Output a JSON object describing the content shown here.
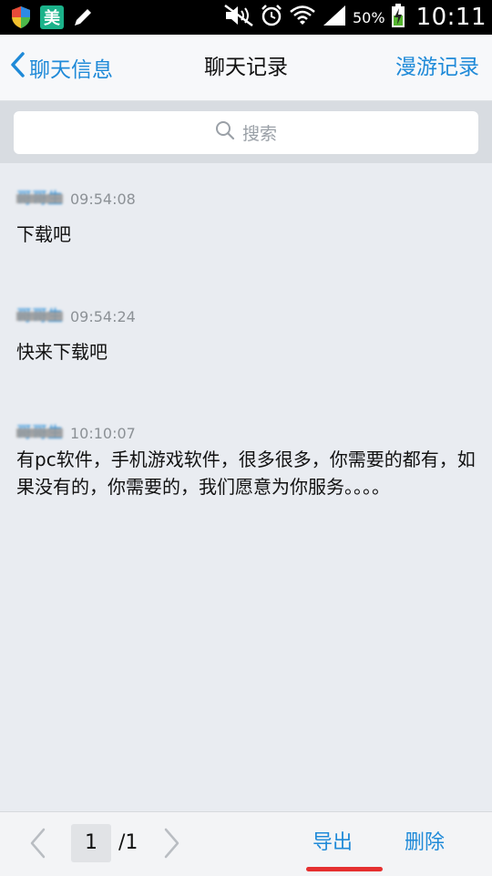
{
  "status_bar": {
    "app_icon_meituan": "美",
    "battery_percent": "50%",
    "time": "10:11"
  },
  "header": {
    "back_label": "聊天信息",
    "title": "聊天记录",
    "roam_label": "漫游记录"
  },
  "search": {
    "placeholder": "搜索"
  },
  "messages": [
    {
      "sender": "哥哥生",
      "time": "09:54:08",
      "text": "下载吧"
    },
    {
      "sender": "哥哥生",
      "time": "09:54:24",
      "text": "快来下载吧"
    },
    {
      "sender": "哥哥生",
      "time": "10:10:07",
      "text": "有pc软件，手机游戏软件，很多很多，你需要的都有，如果没有的，你需要的，我们愿意为你服务。。。。"
    }
  ],
  "pagination": {
    "current_page": "1",
    "total_pages": "/1"
  },
  "actions": {
    "export_label": "导出",
    "delete_label": "删除"
  },
  "colors": {
    "accent": "#1f8ad8",
    "highlight_underline": "#e53030"
  }
}
